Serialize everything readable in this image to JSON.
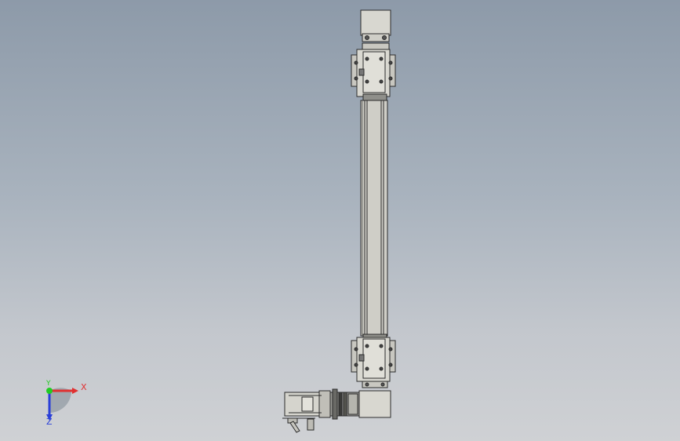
{
  "viewport": {
    "background_top": "#8d9aa9",
    "background_bottom": "#cfd1d4"
  },
  "model": {
    "part_fill": "#d5d4cd",
    "part_dark": "#2b2b2b",
    "part_mid": "#8f8f8a"
  },
  "triad": {
    "x_label": "X",
    "y_label": "Y",
    "z_label": "Z",
    "x_color": "#e03030",
    "y_color": "#22cc22",
    "z_color": "#2a3fd8"
  }
}
